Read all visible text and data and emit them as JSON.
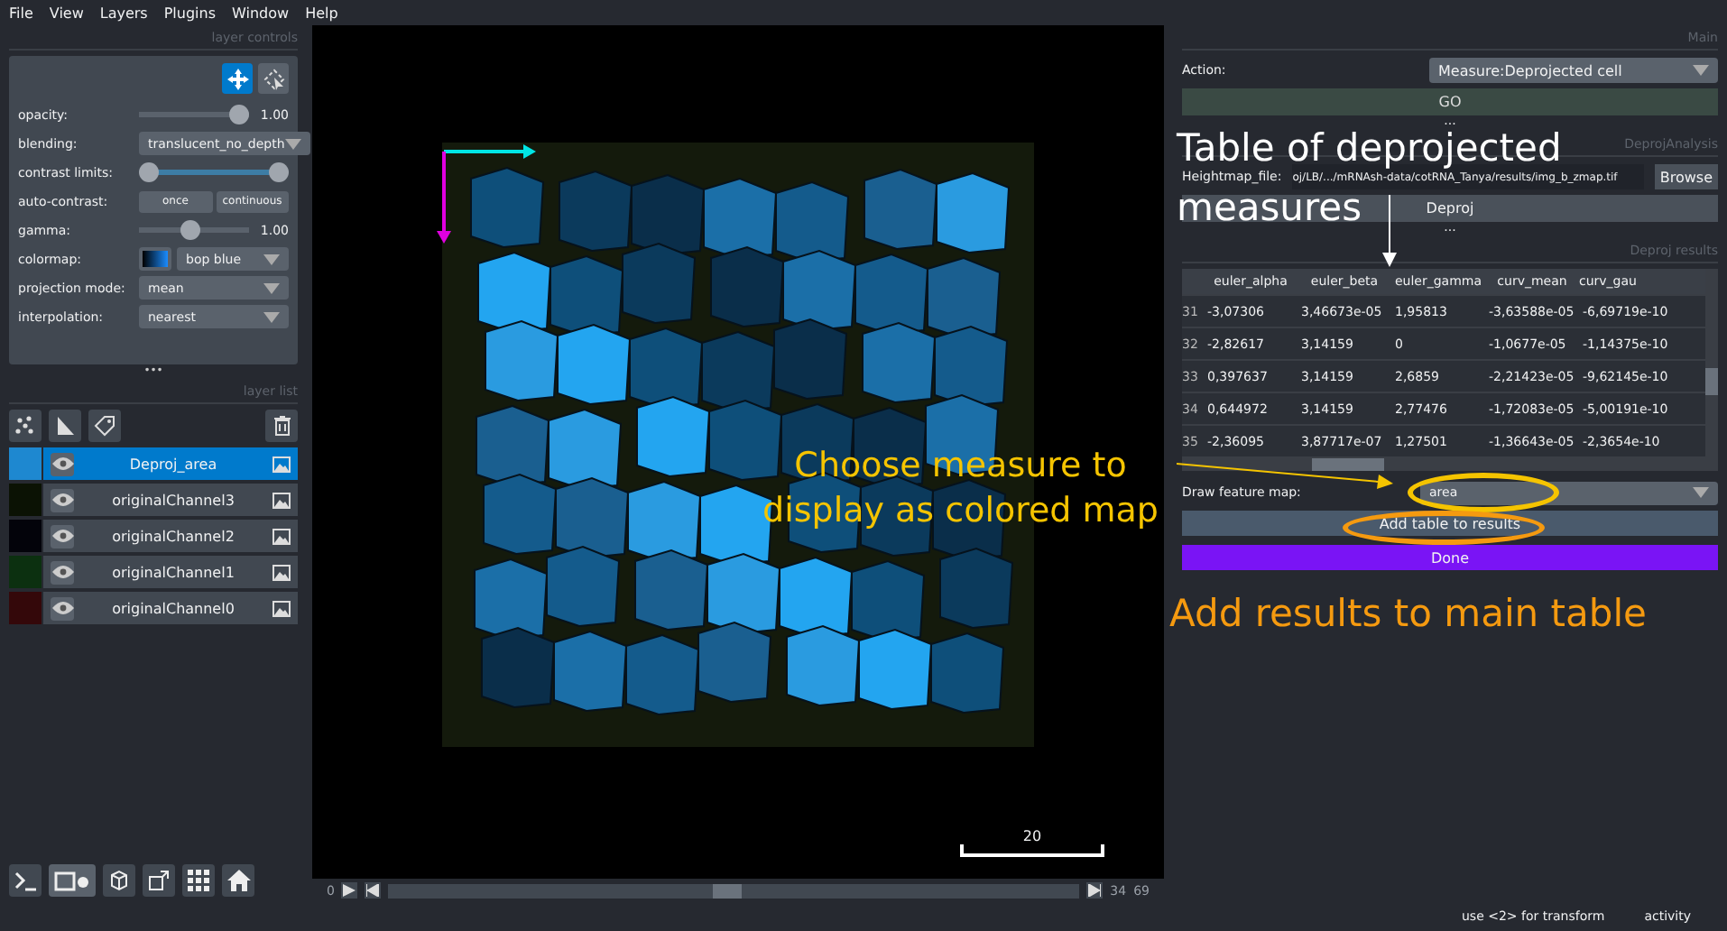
{
  "menu": [
    "File",
    "View",
    "Layers",
    "Plugins",
    "Window",
    "Help"
  ],
  "layer_controls": {
    "title": "layer controls",
    "mode_buttons": [
      {
        "kind": "pan",
        "selected": true
      },
      {
        "kind": "transform",
        "selected": false
      }
    ],
    "rows": [
      {
        "kind": "slider",
        "label": "opacity:",
        "level": 1.0,
        "reading": "1.00"
      },
      {
        "kind": "dropdown",
        "label": "blending:",
        "value": "translucent_no_depth"
      },
      {
        "kind": "range",
        "label": "contrast limits:",
        "level": 1.0
      },
      {
        "kind": "buttons",
        "label": "auto-contrast:",
        "buttons": [
          "once",
          "continuous"
        ]
      },
      {
        "kind": "slider",
        "label": "gamma:",
        "level": 0.45,
        "reading": "1.00"
      },
      {
        "kind": "colormap",
        "label": "colormap:",
        "value": "bop blue"
      },
      {
        "kind": "dropdown",
        "label": "projection mode:",
        "value": "mean"
      },
      {
        "kind": "dropdown",
        "label": "interpolation:",
        "value": "nearest"
      }
    ],
    "more": "•••"
  },
  "layer_list": {
    "title": "layer list",
    "layers": [
      {
        "name": "Deproj_area",
        "selected": true,
        "visible": true,
        "color": "#1e88d0"
      },
      {
        "name": "originalChannel3",
        "selected": false,
        "visible": true,
        "color": "#0b1204"
      },
      {
        "name": "originalChannel2",
        "selected": false,
        "visible": true,
        "color": "#03030a"
      },
      {
        "name": "originalChannel1",
        "selected": false,
        "visible": true,
        "color": "#0c3010"
      },
      {
        "name": "originalChannel0",
        "selected": false,
        "visible": true,
        "color": "#34080a"
      }
    ]
  },
  "dims": {
    "start": "0",
    "level": 0.49,
    "current": "34",
    "total": "69"
  },
  "scale_bar": "20",
  "main": {
    "title": "Main",
    "action_label": "Action:",
    "action_value": "Measure:Deprojected cell",
    "go": "GO",
    "more": "..."
  },
  "deproj_analysis": {
    "title": "DeprojAnalysis",
    "heightmap_label": "Heightmap_file:",
    "heightmap_value": "oj/LB/.../mRNAsh-data/cotRNA_Tanya/results/img_b_zmap.tif",
    "browse": "Browse",
    "deproj": "Deproj",
    "more": "..."
  },
  "deproj_results": {
    "title": "Deproj results",
    "columns": [
      "euler_alpha",
      "euler_beta",
      "euler_gamma",
      "curv_mean",
      "curv_gau"
    ],
    "rows": [
      {
        "index": "31",
        "cells": [
          "-3,07306",
          "3,46673e-05",
          "1,95813",
          "-3,63588e-05",
          "-6,69719e-10"
        ]
      },
      {
        "index": "32",
        "cells": [
          "-2,82617",
          "3,14159",
          "0",
          "-1,0677e-05",
          "-1,14375e-10"
        ]
      },
      {
        "index": "33",
        "cells": [
          "0,397637",
          "3,14159",
          "2,6859",
          "-2,21423e-05",
          "-9,62145e-10"
        ]
      },
      {
        "index": "34",
        "cells": [
          "0,644972",
          "3,14159",
          "2,77476",
          "-1,72083e-05",
          "-5,00191e-10"
        ]
      },
      {
        "index": "35",
        "cells": [
          "-2,36095",
          "3,87717e-07",
          "1,27501",
          "-1,36643e-05",
          "-2,3654e-10"
        ]
      }
    ],
    "feature_label": "Draw feature map:",
    "feature_value": "area",
    "add_table": "Add table to results",
    "done": "Done"
  },
  "status": {
    "message": "use <2> for transform",
    "activity": "activity"
  },
  "annotations": [
    {
      "kind": "white",
      "lines": [
        "Table of deprojected",
        "measures"
      ]
    },
    {
      "kind": "yellow",
      "lines": [
        "Choose measure to",
        "display as colored map"
      ]
    },
    {
      "kind": "orange",
      "lines": [
        "Add results to main table"
      ]
    }
  ]
}
